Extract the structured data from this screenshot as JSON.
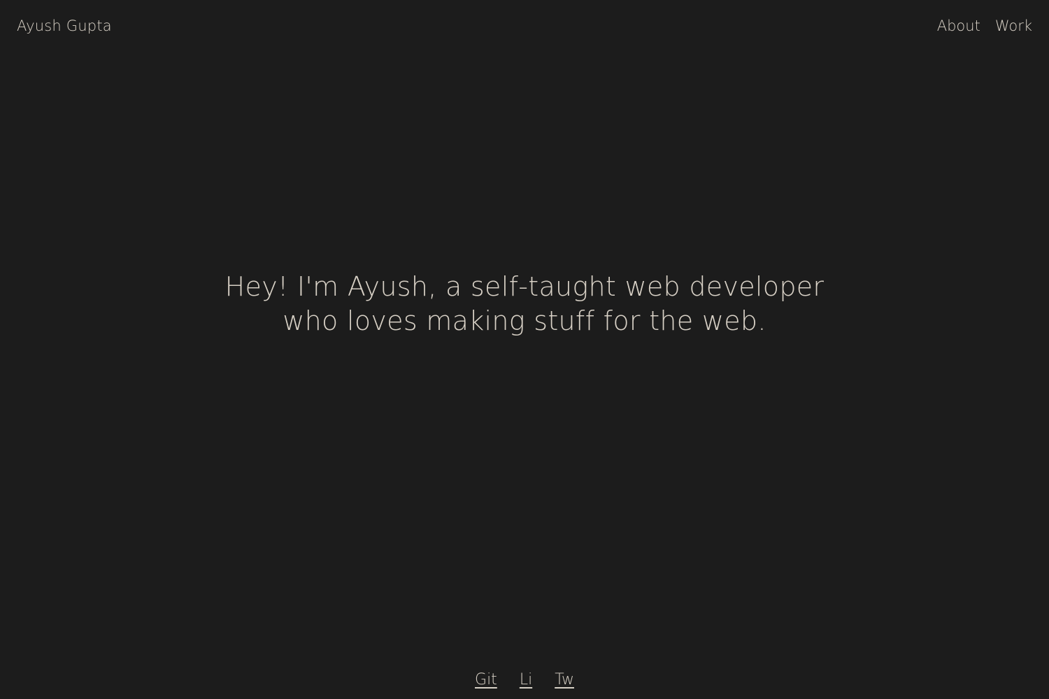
{
  "colors": {
    "background": "#1c1c1c",
    "text": "#d8d1c6"
  },
  "header": {
    "brand": "Ayush Gupta",
    "nav": [
      {
        "label": "About"
      },
      {
        "label": "Work"
      }
    ]
  },
  "hero": {
    "line1": "Hey! I'm Ayush, a self-taught web developer",
    "line2": "who loves making stuff for the web."
  },
  "footer": {
    "links": [
      {
        "label": "Git"
      },
      {
        "label": "Li"
      },
      {
        "label": "Tw"
      }
    ]
  }
}
